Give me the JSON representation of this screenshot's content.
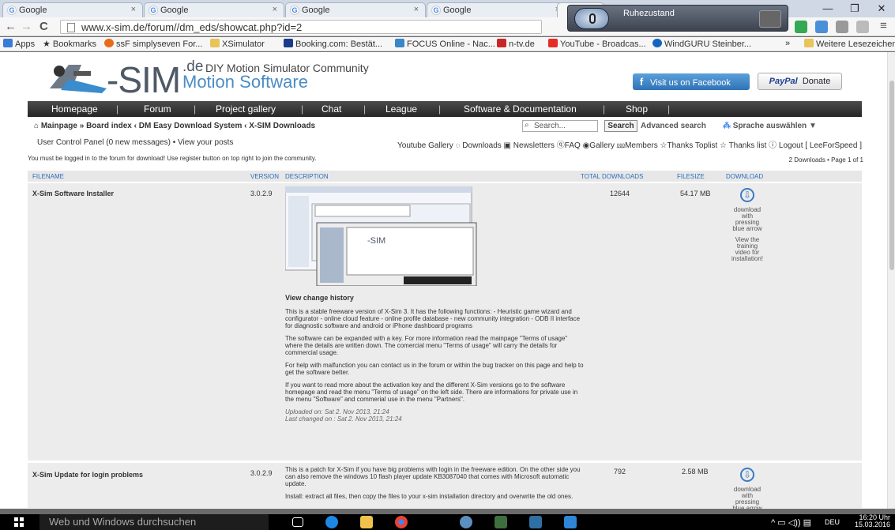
{
  "tabs": [
    {
      "label": "Google"
    },
    {
      "label": "Google"
    },
    {
      "label": "Google"
    },
    {
      "label": "Google"
    },
    {
      "label": ""
    }
  ],
  "window_controls": {
    "minimize": "—",
    "maximize": "❐",
    "close": "✕"
  },
  "address": {
    "url": "www.x-sim.de/forum//dm_eds/showcat.php?id=2",
    "back": "←",
    "forward": "→",
    "reload": "C"
  },
  "bookmarks": [
    {
      "label": "Apps",
      "color": "#3a7bd5"
    },
    {
      "label": "Bookmarks",
      "color": "#222"
    },
    {
      "label": "ssF simplyseven For...",
      "color": "#e86a1b"
    },
    {
      "label": "XSimulator",
      "color": "#e8c45a"
    },
    {
      "label": "Booking.com: Bestät...",
      "color": "#1a3b8a"
    },
    {
      "label": "FOCUS Online - Nac...",
      "color": "#3a86c8"
    },
    {
      "label": "n-tv.de",
      "color": "#c62828"
    },
    {
      "label": "YouTube - Broadcas...",
      "color": "#e52d27"
    },
    {
      "label": "WindGURU Steinber...",
      "color": "#1565c0"
    },
    {
      "label": "»",
      "color": "#fff"
    },
    {
      "label": "Weitere Lesezeichen",
      "color": "#e8c45a"
    }
  ],
  "voice": {
    "status": "Ruhezustand"
  },
  "site": {
    "logo": {
      "sim": "-SIM",
      "de": ".de",
      "tagline": "DIY Motion Simulator Community",
      "sub": "Motion Software"
    },
    "facebook_label": "Visit us on Facebook",
    "donate": {
      "paypal": "PayPal",
      "label": "Donate"
    },
    "menu": [
      "Homepage",
      "Forum",
      "Project gallery",
      "Chat",
      "League",
      "Software & Documentation",
      "Shop"
    ],
    "breadcrumb": "Mainpage » Board index ‹ DM Easy Download System ‹ X-SIM Downloads",
    "search_placeholder": "Search...",
    "search_button": "Search",
    "advanced_search": "Advanced search",
    "language": "Sprache auswählen",
    "ucp": "User Control Panel (0 new messages) • View your posts",
    "toolbar_links": "Youtube Gallery ◌ Downloads ▣ Newsletters ⓠFAQ ◉Gallery ⅏Members ☆Thanks Toplist ☆ Thanks list ⓘ Logout [ LeeForSpeed ]",
    "notice": "You must be logged in to the forum for download! Use register button on top right to join the community.",
    "pager": "2 Downloads • Page 1 of 1",
    "headers": {
      "filename": "FILENAME",
      "version": "VERSION",
      "description": "DESCRIPTION",
      "downloads": "TOTAL DOWNLOADS",
      "filesize": "FILESIZE",
      "download": "DOWNLOAD"
    }
  },
  "rows": [
    {
      "name": "X-Sim Software Installer",
      "version": "3.0.2.9",
      "downloads": "12644",
      "filesize": "54.17 MB",
      "dl_text": "download with pressing blue arrow",
      "dl_text2": "View the training video for installation!",
      "history": "View change history",
      "p1": "This is a stable freeware version of X-Sim 3. It has the following functions: - Heuristic game wizard and configurator - online cloud feature - online profile database - new community integration - ODB II interface for diagnostic software and android or iPhone dashboard programs",
      "p2": "The software can be expanded with a key. For more information read the mainpage \"Terms of usage\" where the details are written down. The comercial menu \"Terms of usage\" will carry the details for commercial usage.",
      "p3": "For help with malfunction you can contact us in the forum or within the bug tracker on this page and help to get the software better.",
      "p4": "If you want to read more about the activation key and the different X-Sim versions go to the software homepage and read the menu \"Terms of usage\" on the left side. There are informations for private use in the menu \"Software\" and commerial use in the menu \"Partners\".",
      "uploaded": "Uploaded on: Sat 2. Nov 2013, 21:24",
      "changed": "Last changed on : Sat 2. Nov 2013, 21:24"
    },
    {
      "name": "X-Sim Update for login problems",
      "version": "3.0.2.9",
      "downloads": "792",
      "filesize": "2.58 MB",
      "dl_text": "download with pressing blue arrow",
      "p1": "This is a patch for X-Sim if you have big problems with login in the freeware edition. On the other side you can also remove the windows 10 flash player update KB3087040 that comes with Microsoft automatic update.",
      "p2": "Install: extract all files, then copy the files to your x-sim installation directory and overwrite the old ones."
    }
  ],
  "taskbar": {
    "search": "Web und Windows durchsuchen",
    "lang": "DEU",
    "time": "16:20 Uhr",
    "date": "15.03.2016"
  }
}
